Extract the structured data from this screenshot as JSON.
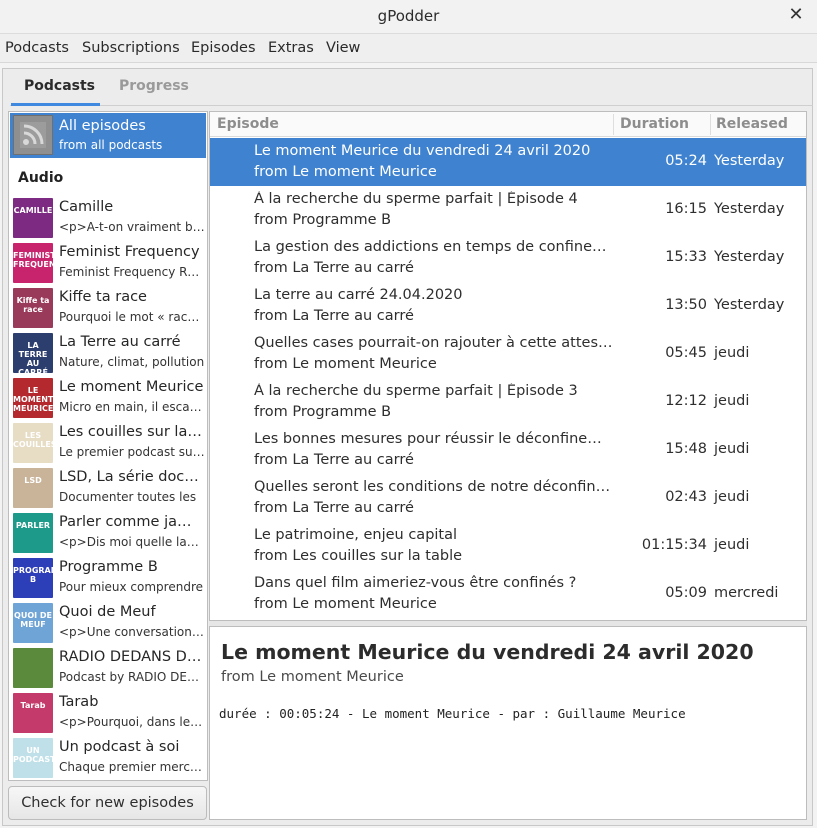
{
  "window": {
    "title": "gPodder",
    "close_glyph": "✕"
  },
  "menu": [
    "Podcasts",
    "Subscriptions",
    "Episodes",
    "Extras",
    "View"
  ],
  "tabs": {
    "active": "Podcasts",
    "inactive": "Progress"
  },
  "sidebar": {
    "all_episodes": {
      "title": "All episodes",
      "subtitle": "from all podcasts",
      "icon": "rss-feed-icon"
    },
    "section": "Audio",
    "podcasts": [
      {
        "title": "Camille",
        "subtitle": "<p>A-t-on vraiment besoin",
        "color": "#7c2a82",
        "cover_text": "CAMILLE"
      },
      {
        "title": "Feminist Frequency",
        "subtitle": "Feminist Frequency Radio",
        "color": "#c8246e",
        "cover_text": "FEMINIST FREQUENCY"
      },
      {
        "title": "Kiffe ta race",
        "subtitle": "Pourquoi le mot « race »",
        "color": "#9a3a5a",
        "cover_text": "Kiffe ta race"
      },
      {
        "title": "La Terre au carré",
        "subtitle": "Nature, climat, pollution",
        "color": "#2c3e6e",
        "cover_text": "LA TERRE AU CARRÉ"
      },
      {
        "title": "Le moment Meurice",
        "subtitle": "Micro en main, il escarmouche",
        "color": "#b4292e",
        "cover_text": "LE MOMENT MEURICE"
      },
      {
        "title": "Les couilles sur la table",
        "subtitle": "Le premier podcast sur les",
        "color": "#e7dcc4",
        "cover_text": "LES COUILLES"
      },
      {
        "title": "LSD, La série documentaire",
        "subtitle": "Documenter toutes les",
        "color": "#c9b49a",
        "cover_text": "LSD"
      },
      {
        "title": "Parler comme jamais",
        "subtitle": "<p>Dis moi quelle langue",
        "color": "#1d9a8a",
        "cover_text": "PARLER"
      },
      {
        "title": "Programme B",
        "subtitle": "Pour mieux comprendre",
        "color": "#2c3fb8",
        "cover_text": "PROGRAMME B"
      },
      {
        "title": "Quoi de Meuf",
        "subtitle": "<p>Une conversation gonflée",
        "color": "#6fa4d6",
        "cover_text": "QUOI DE MEUF"
      },
      {
        "title": "RADIO DEDANS DEHORS",
        "subtitle": "Podcast by RADIO DEDANS",
        "color": "#5c8a3c",
        "cover_text": ""
      },
      {
        "title": "Tarab",
        "subtitle": "<p>Pourquoi, dans le ciel",
        "color": "#c43a6a",
        "cover_text": "Tarab"
      },
      {
        "title": "Un podcast à soi",
        "subtitle": "Chaque premier mercredi",
        "color": "#bfe0e8",
        "cover_text": "UN PODCAST"
      }
    ],
    "check_button": "Check for new episodes"
  },
  "episodes": {
    "columns": {
      "episode": "Episode",
      "duration": "Duration",
      "released": "Released"
    },
    "rows": [
      {
        "title": "Le moment Meurice du vendredi 24 avril 2020",
        "from": "from Le moment Meurice",
        "duration": "05:24",
        "released": "Yesterday",
        "selected": true
      },
      {
        "title": "À la recherche du sperme parfait | Épisode 4",
        "from": "from Programme B",
        "duration": "16:15",
        "released": "Yesterday"
      },
      {
        "title": "La gestion des addictions en temps de confinement",
        "from": "from La Terre au carré",
        "duration": "15:33",
        "released": "Yesterday"
      },
      {
        "title": "La terre au carré 24.04.2020",
        "from": "from La Terre au carré",
        "duration": "13:50",
        "released": "Yesterday"
      },
      {
        "title": "Quelles cases pourrait-on rajouter à cette attestation",
        "from": "from Le moment Meurice",
        "duration": "05:45",
        "released": "jeudi"
      },
      {
        "title": "À la recherche du sperme parfait | Épisode 3",
        "from": "from Programme B",
        "duration": "12:12",
        "released": "jeudi"
      },
      {
        "title": "Les bonnes mesures pour réussir le déconfinement",
        "from": "from La Terre au carré",
        "duration": "15:48",
        "released": "jeudi"
      },
      {
        "title": "Quelles seront les conditions de notre déconfinement",
        "from": "from La Terre au carré",
        "duration": "02:43",
        "released": "jeudi"
      },
      {
        "title": "Le patrimoine, enjeu capital",
        "from": "from Les couilles sur la table",
        "duration": "01:15:34",
        "released": "jeudi"
      },
      {
        "title": "Dans quel film aimeriez-vous être confinés ?",
        "from": "from Le moment Meurice",
        "duration": "05:09",
        "released": "mercredi"
      }
    ]
  },
  "detail": {
    "title": "Le moment Meurice du vendredi 24 avril 2020",
    "subtitle": "from Le moment Meurice",
    "body": "durée : 00:05:24 - Le moment Meurice - par : Guillaume Meurice"
  }
}
